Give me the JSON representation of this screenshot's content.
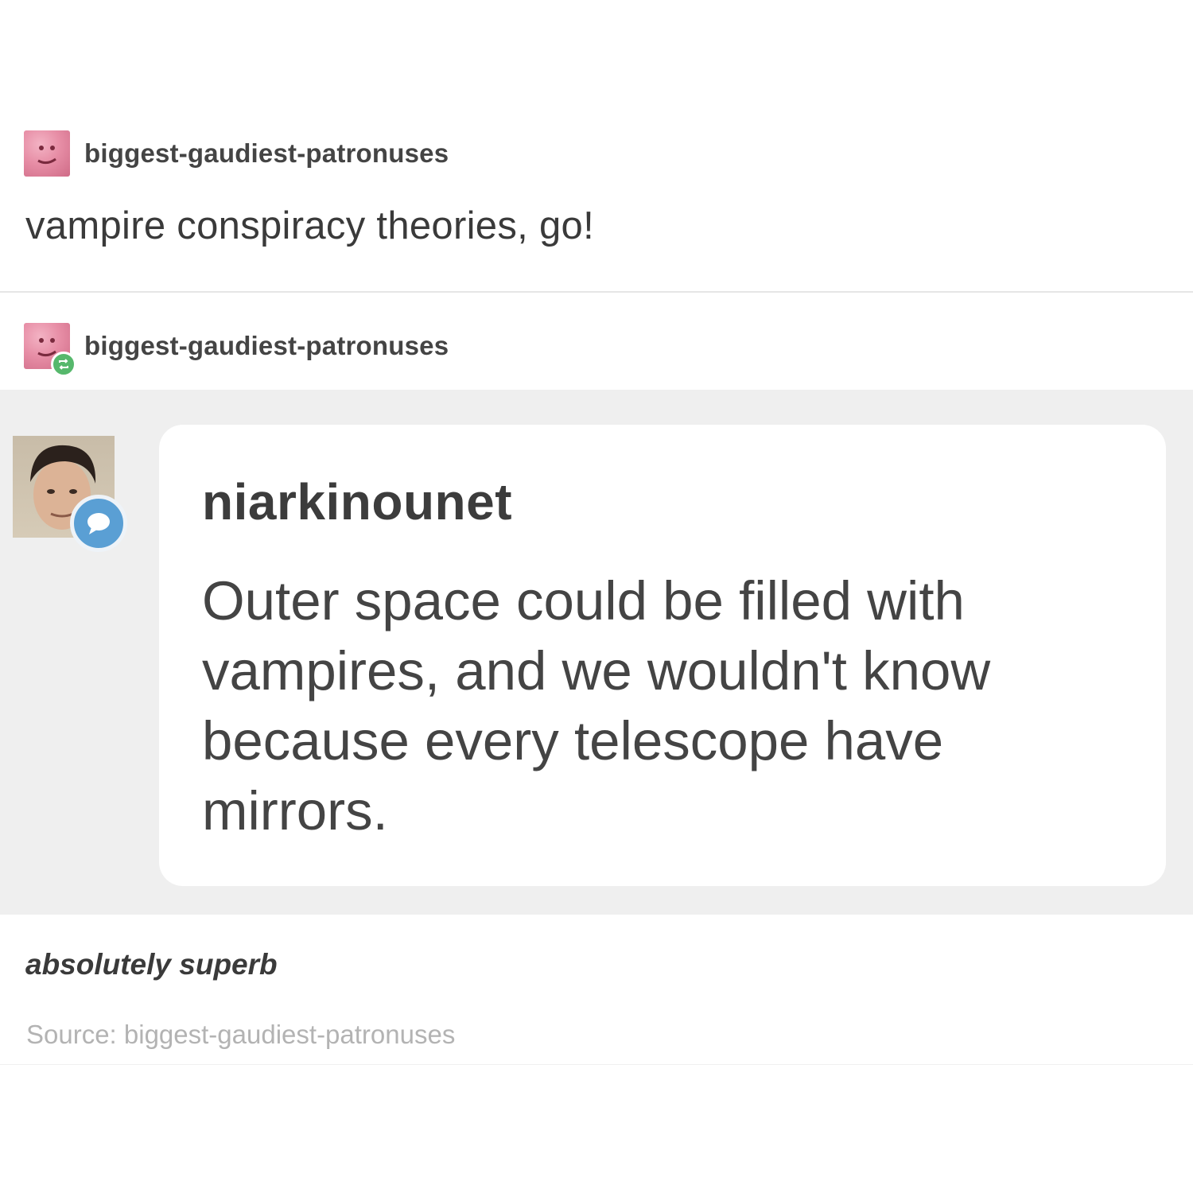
{
  "post": {
    "author": "biggest-gaudiest-patronuses",
    "text": "vampire conspiracy theories, go!"
  },
  "reblog": {
    "author": "biggest-gaudiest-patronuses",
    "badge_icon": "reblog-icon"
  },
  "ask": {
    "asker": "niarkinounet",
    "badge_icon": "speech-bubble-icon",
    "question": "Outer space could be filled with vampires, and we wouldn't know because every telescope have mirrors."
  },
  "comment": "absolutely superb",
  "source": "Source: biggest-gaudiest-patronuses",
  "colors": {
    "avatar_pink": "#e78ea6",
    "reblog_green": "#56b86c",
    "ask_blue": "#5a9fd4",
    "band_grey": "#efefef",
    "source_grey": "#b3b3b3"
  }
}
